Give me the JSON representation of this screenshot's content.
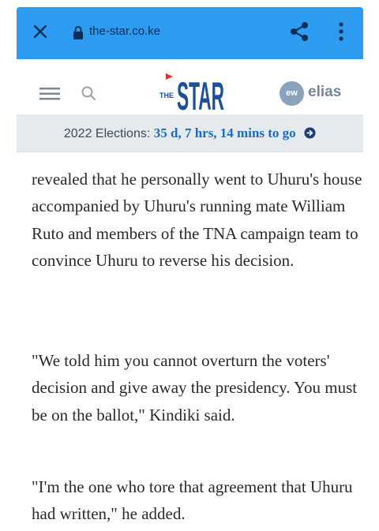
{
  "browser": {
    "url": "the-star.co.ke"
  },
  "header": {
    "logo_small": "THE",
    "logo_main": "STAR",
    "avatar_initials": "ew",
    "username": "elias"
  },
  "election_banner": {
    "label": "2022 Elections:",
    "countdown": "35 d, 7 hrs, 14 mins to go"
  },
  "article": {
    "partial_line": "...",
    "paragraphs": [
      "revealed that he personally went to Uhuru's house accompanied by Uhuru's running mate William Ruto and members of the TNA campaign team to convince Uhuru to reverse his decision.",
      "\"We told him you cannot overturn the voters' decision and give away the presidency. You must be on the ballot,\" Kindiki said.",
      "\"I'm the one who tore that agreement that Uhuru had written,\" he added."
    ]
  },
  "colors": {
    "browser_bar": "#2d9bf0",
    "logo_blue": "#1c4f9c",
    "countdown_blue": "#1a6cc4",
    "banner_bg": "#e5eaee"
  }
}
